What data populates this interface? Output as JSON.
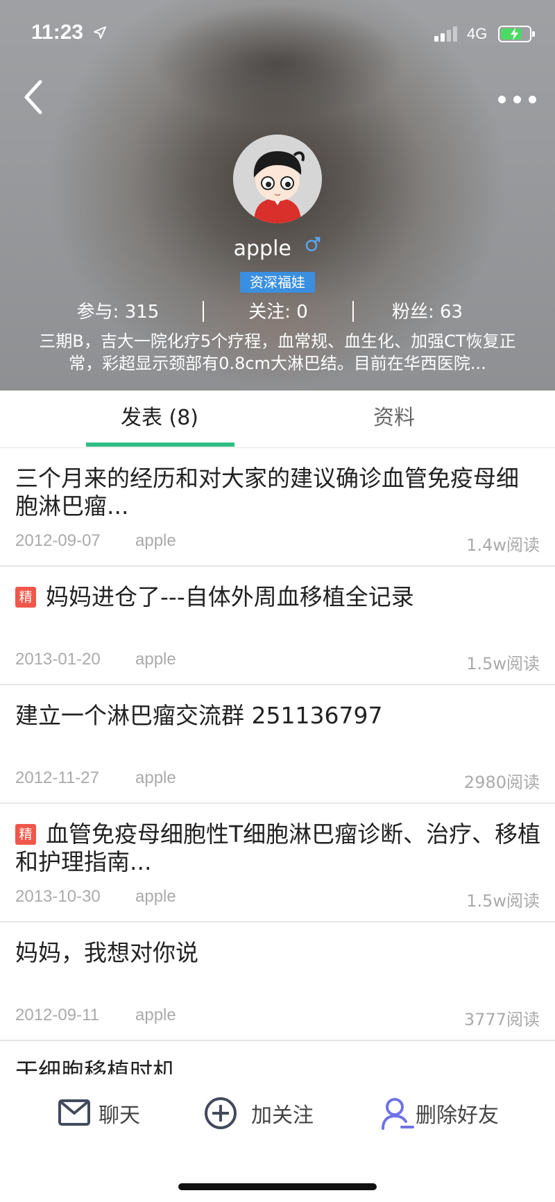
{
  "status_bar": {
    "time": "11:23",
    "network": "4G",
    "icons": [
      "location-arrow-icon",
      "signal-icon",
      "battery-charging-icon"
    ]
  },
  "nav": {
    "back_icon": "chevron-left-icon",
    "more_icon": "more-dots-icon"
  },
  "profile": {
    "name": "apple",
    "gender_icon": "male-icon",
    "badge": "资深福娃",
    "stats": [
      {
        "label": "参与: 315"
      },
      {
        "label": "关注: 0"
      },
      {
        "label": "粉丝: 63"
      }
    ],
    "bio": "三期B，吉大一院化疗5个疗程，血常规、血生化、加强CT恢复正常，彩超显示颈部有0.8cm大淋巴结。目前在华西医院..."
  },
  "tabs": [
    {
      "label": "发表 (8)",
      "active": true
    },
    {
      "label": "资料",
      "active": false
    }
  ],
  "accent_color": "#2ebd85",
  "tag_color": "#f0574a",
  "posts": [
    {
      "title": "三个月来的经历和对大家的建议确诊血管免疫母细胞淋巴瘤...",
      "featured": false,
      "date": "2012-09-07",
      "author": "apple",
      "reads": "1.4w阅读"
    },
    {
      "title": "妈妈进仓了---自体外周血移植全记录",
      "featured": true,
      "tag": "精",
      "date": "2013-01-20",
      "author": "apple",
      "reads": "1.5w阅读"
    },
    {
      "title": "建立一个淋巴瘤交流群 251136797",
      "featured": false,
      "date": "2012-11-27",
      "author": "apple",
      "reads": "2980阅读"
    },
    {
      "title": "血管免疫母细胞性T细胞淋巴瘤诊断、治疗、移植和护理指南...",
      "featured": true,
      "tag": "精",
      "date": "2013-10-30",
      "author": "apple",
      "reads": "1.5w阅读"
    },
    {
      "title": "妈妈，我想对你说",
      "featured": false,
      "date": "2012-09-11",
      "author": "apple",
      "reads": "3777阅读"
    },
    {
      "title": "干细胞移植时机",
      "featured": false,
      "date": "",
      "author": "",
      "reads": ""
    }
  ],
  "actions": {
    "chat": {
      "label": "聊天",
      "icon": "mail-icon"
    },
    "follow": {
      "label": "加关注",
      "icon": "plus-circle-icon"
    },
    "unfriend": {
      "label": "删除好友",
      "icon": "remove-user-icon"
    }
  }
}
